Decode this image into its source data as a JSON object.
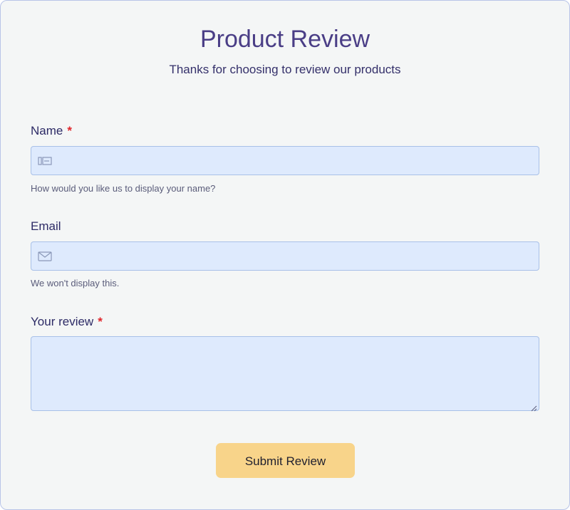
{
  "header": {
    "title": "Product Review",
    "subtitle": "Thanks for choosing to review our products"
  },
  "form": {
    "name": {
      "label": "Name",
      "required_marker": "*",
      "value": "",
      "help": "How would you like us to display your name?",
      "icon": "id-card-icon"
    },
    "email": {
      "label": "Email",
      "value": "",
      "help": "We won't display this.",
      "icon": "envelope-icon"
    },
    "review": {
      "label": "Your review",
      "required_marker": "*",
      "value": ""
    },
    "submit_label": "Submit Review"
  },
  "colors": {
    "title": "#4a3e86",
    "field_bg": "#deeafd",
    "field_border": "#a8c0e8",
    "required": "#e0262b",
    "button": "#f8d48a",
    "card_bg": "#f4f6f6"
  }
}
